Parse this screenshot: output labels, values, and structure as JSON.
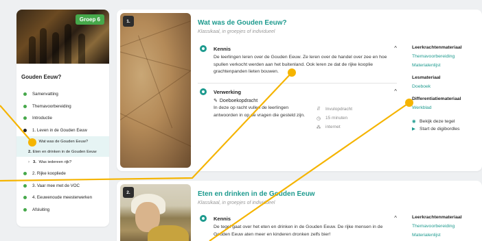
{
  "sidebar": {
    "grade_badge": "Groep 6",
    "title": "Gouden Eeuw?",
    "items": [
      {
        "label": "Samenvatting"
      },
      {
        "label": "Themavoorbereiding"
      },
      {
        "label": "Introductie"
      },
      {
        "label": "1. Leven in de Gouden Eeuw"
      }
    ],
    "subitems": [
      {
        "num": "1.",
        "label": "Wat was de Gouden Eeuw?"
      },
      {
        "num": "2.",
        "label": "Eten en drinken in de Gouden Eeuw"
      },
      {
        "num": "3.",
        "label": "Was iedereen rijk?"
      }
    ],
    "items_after": [
      {
        "label": "2. Rijke koopliede"
      },
      {
        "label": "3. Vaar mee met de VOC"
      },
      {
        "label": "4. Eeuwenoude meesterwerken"
      },
      {
        "label": "Afsluiting"
      }
    ]
  },
  "cards": [
    {
      "number": "1.",
      "title": "Wat was de Gouden Eeuw?",
      "subtitle": "Klassikaal, in groepjes of individueel",
      "kennis": {
        "heading": "Kennis",
        "body": "De leerlingen leren over de Gouden Eeuw. Ze leren over de handel over zee en hoe spullen verkocht werden aan het buitenland. Ook leren ze dat de rijke kooplie   grachtenpanden lieten bouwen."
      },
      "verwerking": {
        "heading": "Verwerking",
        "task_title": "Doeboekopdracht",
        "task_desc": "In deze op   racht vullen de leerlingen antwoorden in op de vragen die gesteld zijn.",
        "meta": [
          "Invulopdracht",
          "15 minuten",
          "internet"
        ]
      },
      "materials": {
        "leerkracht_head": "Leerkrachtenmateriaal",
        "leerkracht_links": [
          "Themavoorbereiding",
          "Materialenlijst"
        ],
        "les_head": "Lesmateriaal",
        "les_links": [
          "Doeboek"
        ],
        "diff_head": "Differentiatiemateriaal",
        "diff_links": [
          "Werkblad"
        ],
        "actions": [
          "Bekijk deze tegel",
          "Start de digibordles"
        ]
      }
    },
    {
      "number": "2.",
      "title": "Eten en drinken in de Gouden Eeuw",
      "subtitle": "Klassikaal, in groepjes of individueel",
      "kennis": {
        "heading": "Kennis",
        "body": "De tegel gaat over het eten en drinken in de Gouden Eeuw. De rijke mensen in de Gouden Eeuw aten meer en kinderen dronken zelfs bier!"
      },
      "materials": {
        "leerkracht_head": "Leerkrachtenmateriaal",
        "leerkracht_links": [
          "Themavoorbereiding",
          "Materialenlijst"
        ]
      }
    }
  ],
  "icons": {
    "section_expand": "chevron-up-icon",
    "task": "doeboek-icon"
  },
  "colors": {
    "accent": "#1d9a8e",
    "green": "#46a84b",
    "highlight": "#f5b400"
  }
}
